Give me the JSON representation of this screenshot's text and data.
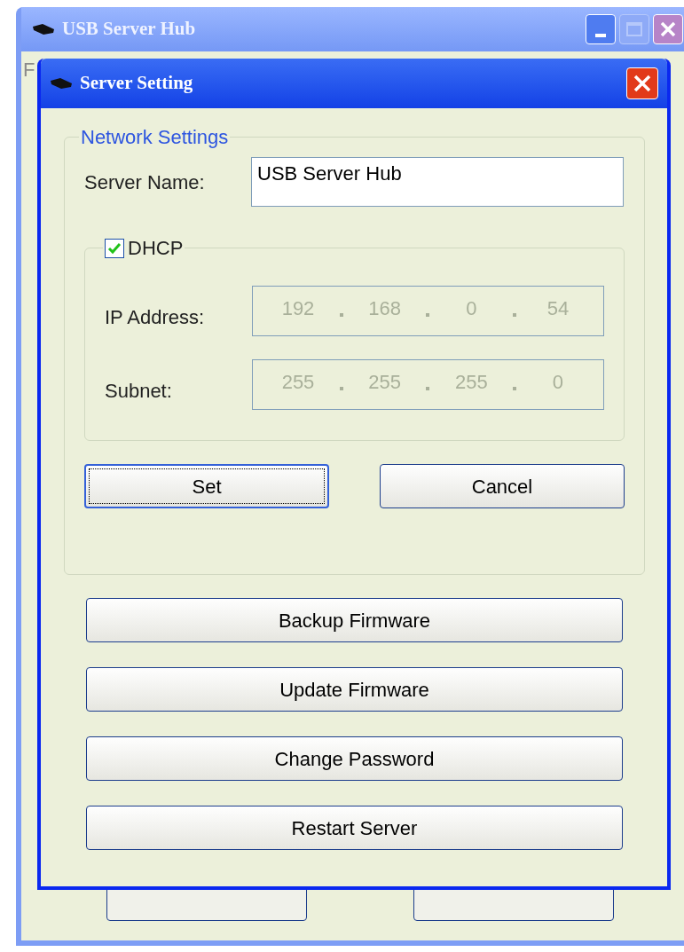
{
  "main_window": {
    "title": "USB Server Hub",
    "menu": [
      "F"
    ],
    "minimize_disabled": false,
    "maximize_disabled": true
  },
  "dialog": {
    "title": "Server Setting",
    "network_group": {
      "title": "Network Settings",
      "server_name": {
        "label": "Server Name:",
        "value": "USB Server Hub"
      },
      "dhcp": {
        "label": "DHCP",
        "checked": true
      },
      "address_fields": [
        {
          "label": "IP Address:",
          "octets": [
            "192",
            "168",
            "0",
            "54"
          ],
          "disabled": true
        },
        {
          "label": "Subnet:",
          "octets": [
            "255",
            "255",
            "255",
            "0"
          ],
          "disabled": true
        }
      ],
      "buttons": [
        {
          "label": "Set",
          "focused": true
        },
        {
          "label": "Cancel",
          "focused": false
        }
      ]
    },
    "actions": [
      "Backup Firmware",
      "Update Firmware",
      "Change Password",
      "Restart Server"
    ]
  }
}
